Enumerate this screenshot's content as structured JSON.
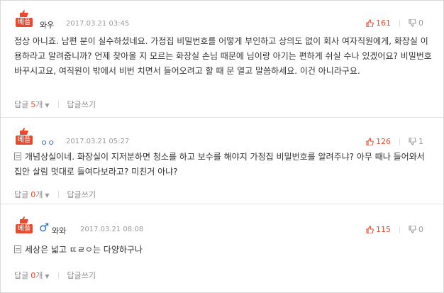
{
  "best_label": "베플",
  "reply_label": "답글",
  "write_reply_label": "답글쓰기",
  "count_suffix": "개",
  "comments": [
    {
      "author": "와우",
      "date": "2017.03.21 03:45",
      "up": "161",
      "down": "0",
      "body": "정상 아니죠. 남편 분이 실수하셨네요. 가정집 비밀번호를 어떻게 부인하고 상의도 없이 회사 여자직원에게, 화장실 이용하라고 알려줍니까? 언제 찾아올 지 모르는 화장실 손님 때문에 님이랑 아기는 편하게 쉬실 수나 있겠어요? 비밀번호 바꾸시고요, 여직원이 밖에서 비번 치면서 들어오려고 할 때 문 열고 말씀하세요. 이건 아니라구요.",
      "reply_count": "5",
      "gender_icon": ""
    },
    {
      "author": "ㅇㅇ",
      "date": "2017.03.21 05:27",
      "up": "126",
      "down": "1",
      "body": "개념상실이네. 화장실이 지저분하면 청소를 하고 보수를 해야지 가정집 비밀번호를 알려주냐? 아무 때나 들어와서 집안 살림 멋대로 들여다보라고? 미친거 아냐?",
      "reply_count": "0",
      "gender_icon": ""
    },
    {
      "author": "와와",
      "date": "2017.03.21 08:08",
      "up": "115",
      "down": "0",
      "body": "세상은 넓고 ㄸㄹㅇ는 다양하구나",
      "reply_count": "0",
      "gender_icon": "male-symbol"
    }
  ],
  "colors": {
    "accent": "#e8492f",
    "muted": "#9a9a9a",
    "border": "#e2e2e2",
    "male": "#2b6bd6"
  }
}
